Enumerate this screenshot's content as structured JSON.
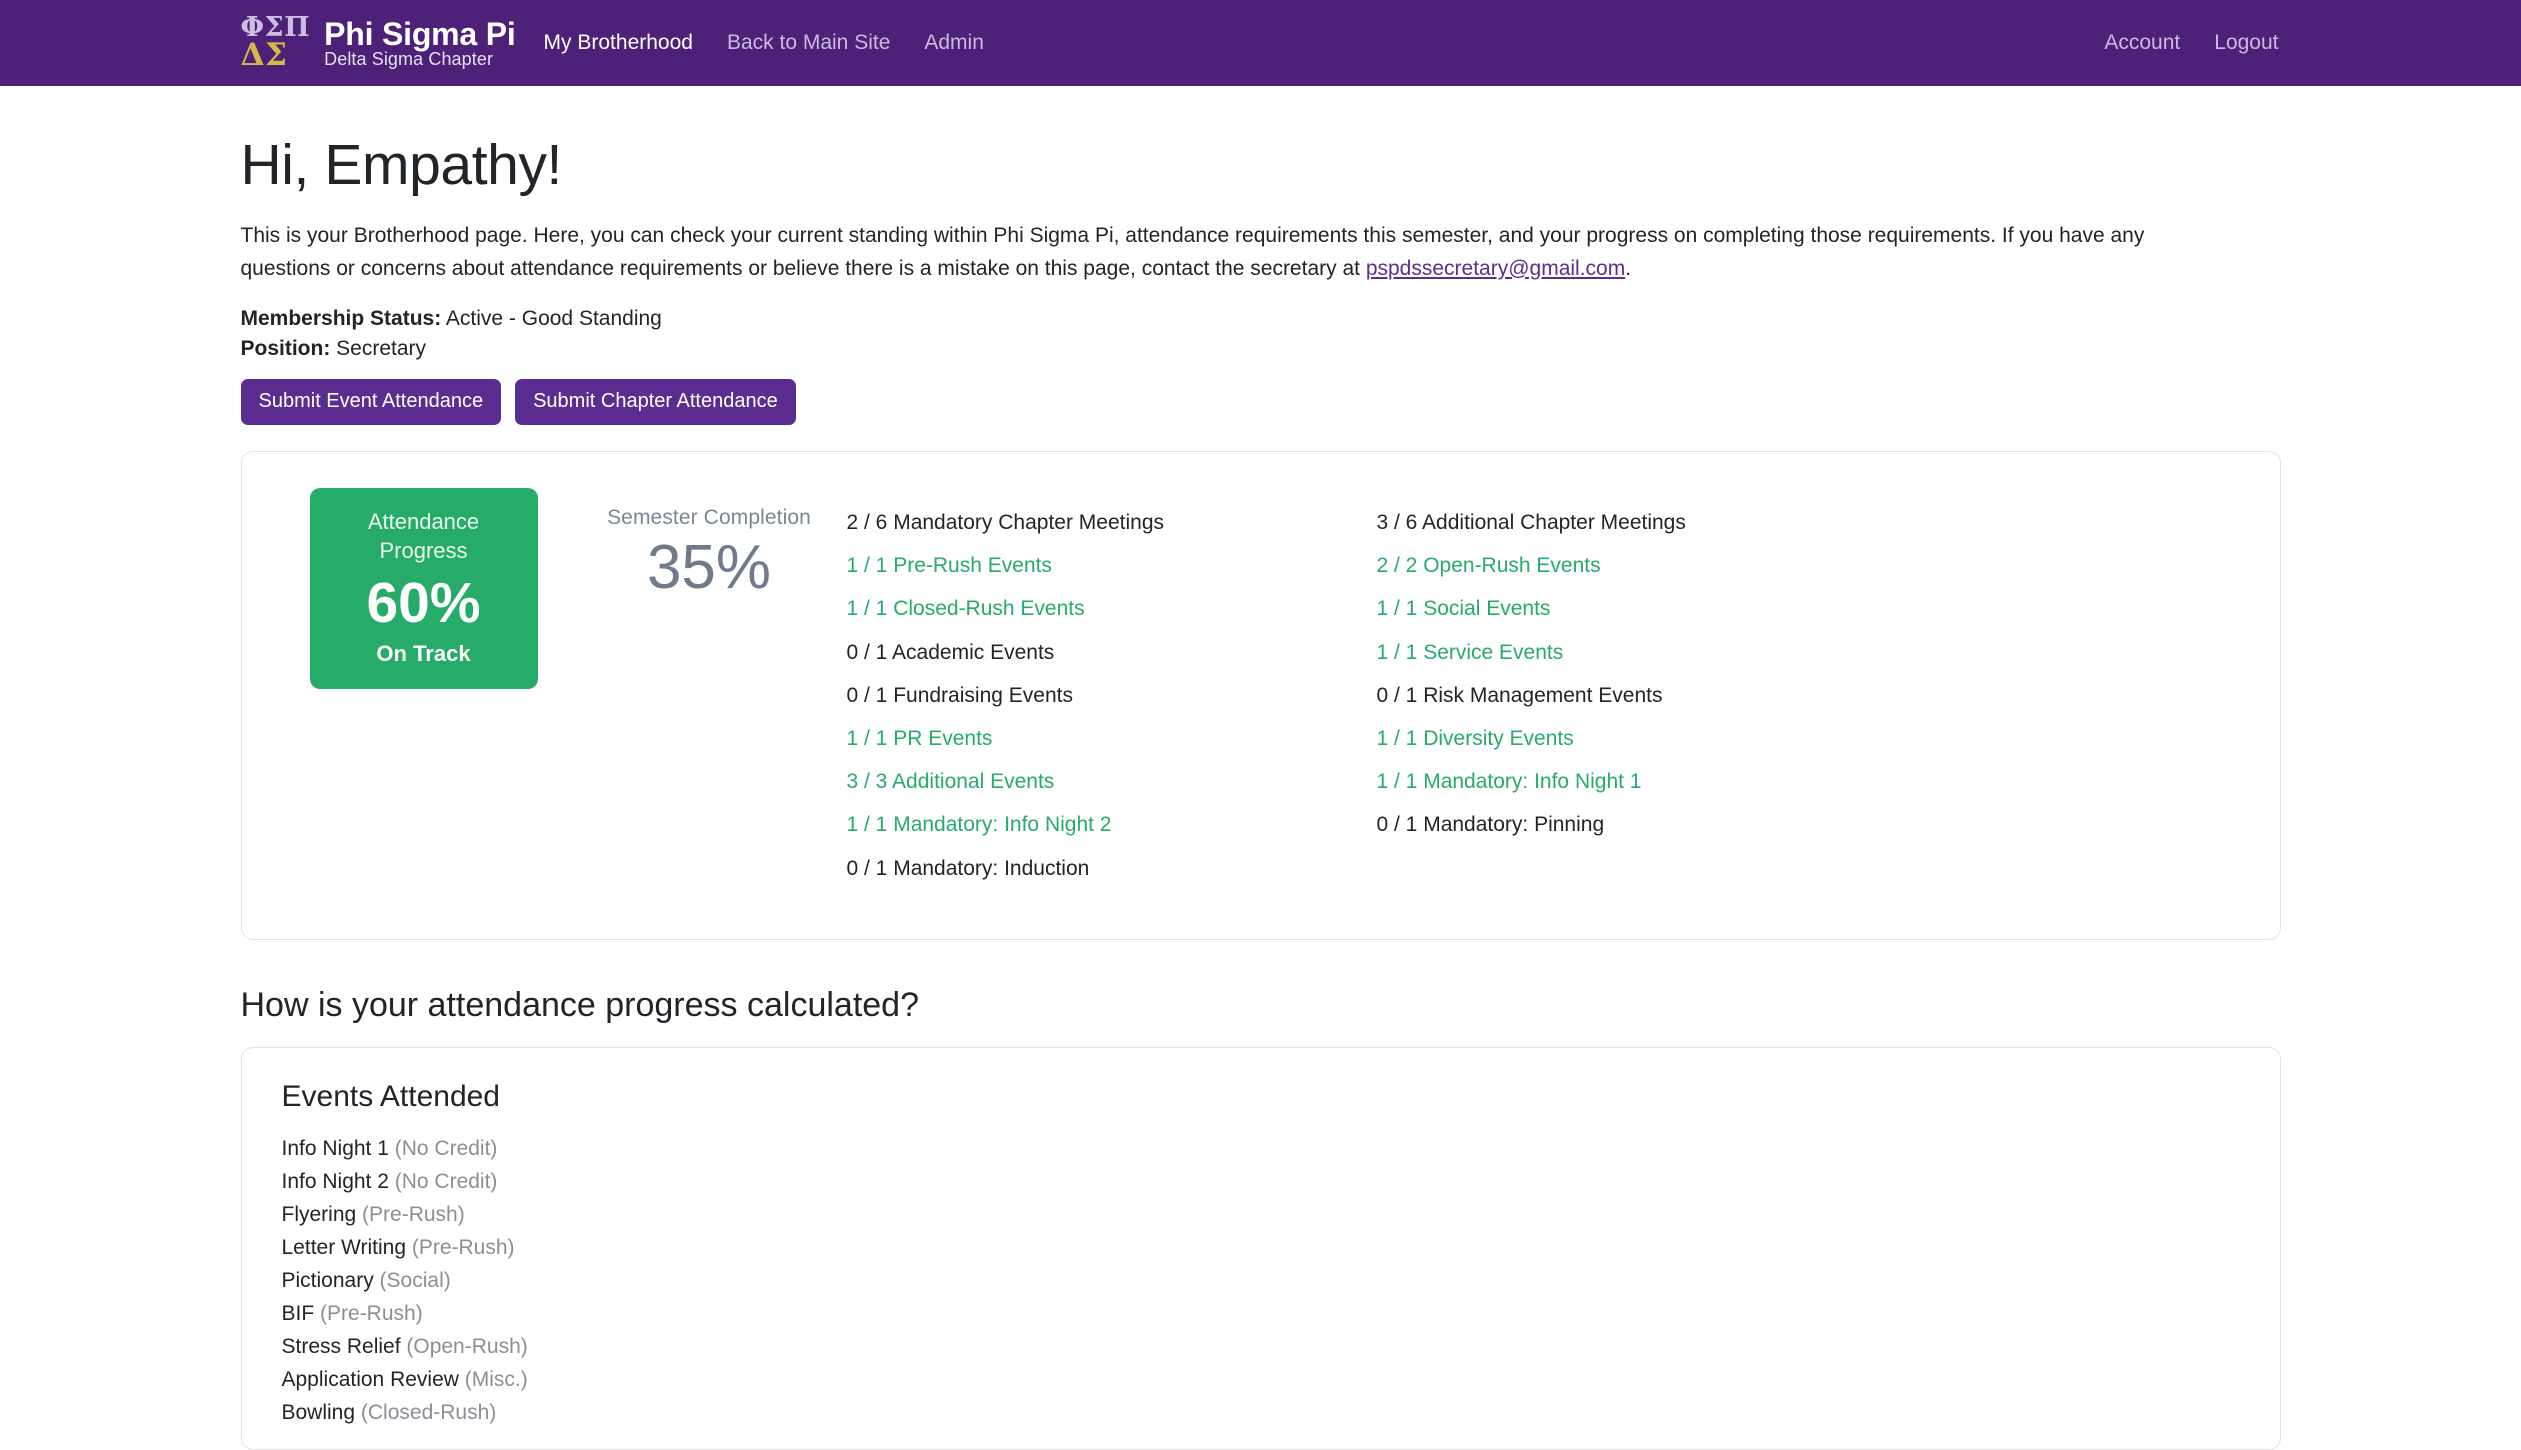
{
  "navbar": {
    "brand": {
      "greek_top": "ΦΣΠ",
      "greek_bottom": "ΔΣ",
      "title": "Phi Sigma Pi",
      "subtitle": "Delta Sigma Chapter"
    },
    "links": [
      {
        "label": "My Brotherhood",
        "active": true
      },
      {
        "label": "Back to Main Site",
        "active": false
      },
      {
        "label": "Admin",
        "active": false
      }
    ],
    "right_links": [
      {
        "label": "Account"
      },
      {
        "label": "Logout"
      }
    ],
    "background_color": "#4d2177"
  },
  "page": {
    "title": "Hi, Empathy!",
    "intro_part1": "This is your Brotherhood page. Here, you can check your current standing within Phi Sigma Pi, attendance requirements this semester, and your progress on completing those requirements. If you have any questions or concerns about attendance requirements or believe there is a mistake on this page, contact the secretary at ",
    "intro_email": "pspdssecretary@gmail.com",
    "intro_part2": ".",
    "membership_status_label": "Membership Status:",
    "membership_status_value": "Active - Good Standing",
    "position_label": "Position:",
    "position_value": "Secretary"
  },
  "actions": {
    "submit_event_attendance": "Submit Event Attendance",
    "submit_chapter_attendance": "Submit Chapter Attendance",
    "button_color": "#5c2d91"
  },
  "progress": {
    "badge_title_line1": "Attendance",
    "badge_title_line2": "Progress",
    "badge_percent": "60%",
    "badge_status": "On Track",
    "badge_color": "#27ab69",
    "semester_label": "Semester Completion",
    "semester_percent": "35%",
    "requirements_left": [
      {
        "text": "2 / 6 Mandatory Chapter Meetings",
        "met": false
      },
      {
        "text": "1 / 1 Pre-Rush Events",
        "met": true
      },
      {
        "text": "1 / 1 Closed-Rush Events",
        "met": true
      },
      {
        "text": "0 / 1 Academic Events",
        "met": false
      },
      {
        "text": "0 / 1 Fundraising Events",
        "met": false
      },
      {
        "text": "1 / 1 PR Events",
        "met": true
      },
      {
        "text": "3 / 3 Additional Events",
        "met": true
      },
      {
        "text": "1 / 1 Mandatory: Info Night 2",
        "met": true
      },
      {
        "text": "0 / 1 Mandatory: Induction",
        "met": false
      }
    ],
    "requirements_right": [
      {
        "text": "3 / 6 Additional Chapter Meetings",
        "met": false
      },
      {
        "text": "2 / 2 Open-Rush Events",
        "met": true
      },
      {
        "text": "1 / 1 Social Events",
        "met": true
      },
      {
        "text": "1 / 1 Service Events",
        "met": true
      },
      {
        "text": "0 / 1 Risk Management Events",
        "met": false
      },
      {
        "text": "1 / 1 Diversity Events",
        "met": true
      },
      {
        "text": "1 / 1 Mandatory: Info Night 1",
        "met": true
      },
      {
        "text": "0 / 1 Mandatory: Pinning",
        "met": false
      }
    ]
  },
  "how_section": {
    "heading": "How is your attendance progress calculated?",
    "events_card_title": "Events Attended",
    "events": [
      {
        "name": "Info Night 1",
        "category": "(No Credit)"
      },
      {
        "name": "Info Night 2",
        "category": "(No Credit)"
      },
      {
        "name": "Flyering",
        "category": "(Pre-Rush)"
      },
      {
        "name": "Letter Writing",
        "category": "(Pre-Rush)"
      },
      {
        "name": "Pictionary",
        "category": "(Social)"
      },
      {
        "name": "BIF",
        "category": "(Pre-Rush)"
      },
      {
        "name": "Stress Relief",
        "category": "(Open-Rush)"
      },
      {
        "name": "Application Review",
        "category": "(Misc.)"
      },
      {
        "name": "Bowling",
        "category": "(Closed-Rush)"
      }
    ]
  }
}
